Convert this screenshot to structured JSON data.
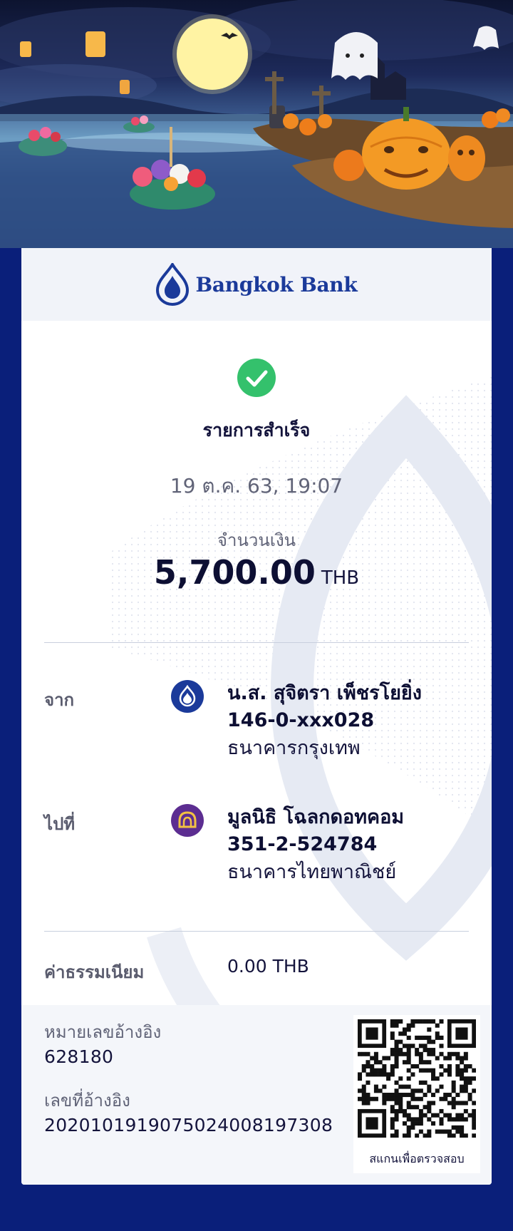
{
  "bank": {
    "name": "Bangkok Bank",
    "brand_color": "#1b3a9a"
  },
  "status": {
    "title": "รายการสำเร็จ",
    "icon": "check-circle-icon",
    "color": "#34c16c"
  },
  "datetime": "19 ต.ค. 63, 19:07",
  "amount": {
    "label": "จำนวนเงิน",
    "value": "5,700.00",
    "currency": "THB"
  },
  "from": {
    "label": "จาก",
    "name": "น.ส. สุจิตรา เพ็ชรโยยิ่ง",
    "account": "146-0-xxx028",
    "bank": "ธนาคารกรุงเทพ",
    "icon": "bangkok-bank-logo-icon",
    "icon_color": "#1b3a9a"
  },
  "to": {
    "label": "ไปที่",
    "name": "มูลนิธิ โฉลกดอทคอม",
    "account": "351-2-524784",
    "bank": "ธนาคารไทยพาณิชย์",
    "icon": "scb-logo-icon",
    "icon_color": "#5c2d91"
  },
  "fee": {
    "label": "ค่าธรรมเนียม",
    "value": "0.00 THB"
  },
  "reference": {
    "ref_label": "หมายเลขอ้างอิง",
    "ref_value": "628180",
    "txn_label": "เลขที่อ้างอิง",
    "txn_value": "20201019190750240081973​08"
  },
  "qr": {
    "caption": "สแกนเพื่อตรวจสอบ",
    "icon": "qr-code-icon"
  }
}
